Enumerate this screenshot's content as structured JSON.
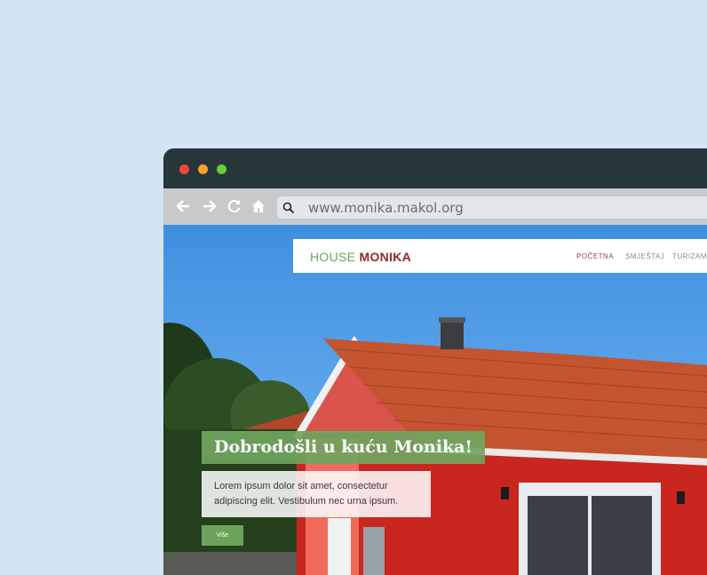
{
  "browser": {
    "url": "www.monika.makol.org",
    "icons": {
      "back": "arrow-left-icon",
      "forward": "arrow-right-icon",
      "reload": "reload-icon",
      "home": "home-icon",
      "search": "search-icon"
    }
  },
  "site": {
    "logo_part1": "HOUSE",
    "logo_part2": "MONIKA",
    "nav": [
      "POČETNA",
      "SMJEŠTAJ",
      "TURIZAM"
    ]
  },
  "hero": {
    "title": "Dobrodošli u kuću Monika!",
    "text": "Lorem ipsum dolor sit amet, consectetur adipiscing elit. Vestibulum nec urna ipsum.",
    "button": "Više"
  },
  "colors": {
    "page_bg": "#d3e4f3",
    "titlebar": "#26363a",
    "brand_green": "#6ba35a",
    "brand_red": "#8e2a2a"
  }
}
